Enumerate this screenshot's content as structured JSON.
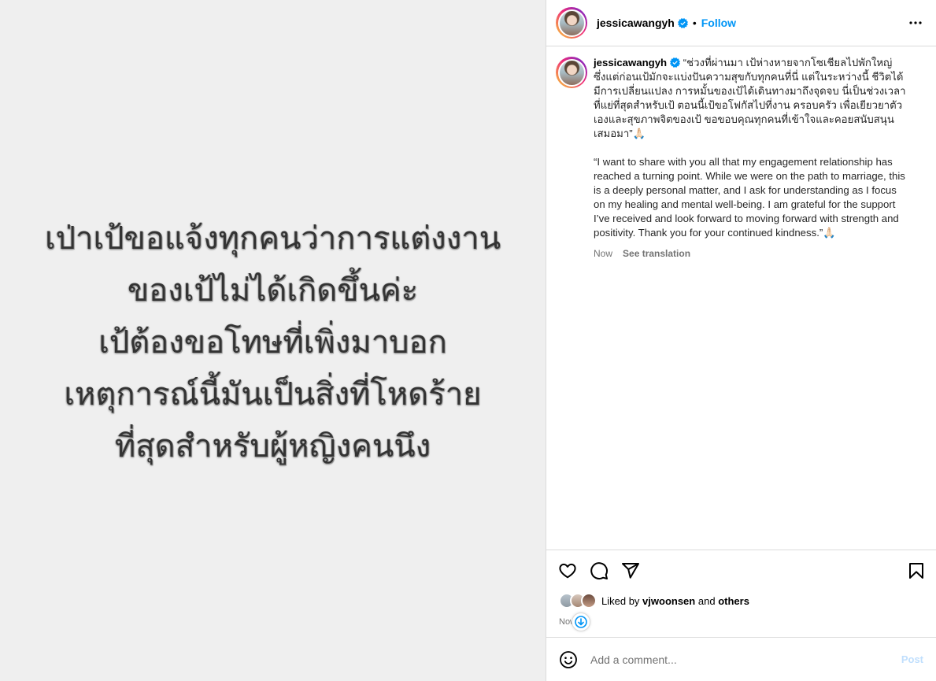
{
  "media": {
    "lines": [
      "เป่าเป้ขอแจ้งทุกคนว่าการแต่งงาน",
      "ของเป้ไม่ได้เกิดขึ้นค่ะ",
      "เป้ต้องขอโทษที่เพิ่งมาบอก",
      "เหตุการณ์นี้มันเป็นสิ่งที่โหดร้าย",
      "ที่สุดสำหรับผู้หญิงคนนึง"
    ]
  },
  "header": {
    "username": "jessicawangyh",
    "separator": "•",
    "follow_label": "Follow"
  },
  "caption": {
    "username": "jessicawangyh",
    "thai_text": "“ช่วงที่ผ่านมา เป้ห่างหายจากโซเชียลไปพักใหญ่ ซึ่งแต่ก่อนเป้มักจะแบ่งปันความสุขกับทุกคนที่นี่ แต่ในระหว่างนี้ ชีวิตได้มีการเปลี่ยนแปลง การหมั้นของเป้ได้เดินทางมาถึงจุดจบ นี่เป็นช่วงเวลาที่แย่ที่สุดสำหรับเป้ ตอนนี้เป้ขอโฟกัสไปที่งาน ครอบครัว เพื่อเยียวยาตัวเองและสุขภาพจิตของเป้ ขอขอบคุณทุกคนที่เข้าใจและคอยสนับสนุนเสมอมา”🙏🏻",
    "english_text": "“I want to share with you all that my engagement relationship has reached a turning point. While we were on the path to marriage, this is a deeply personal matter, and I ask for understanding as I focus on my healing and mental well-being. I am grateful for the support I’ve received and look forward to moving forward with strength and positivity. Thank you for your continued kindness.”🙏🏻",
    "time": "Now",
    "see_translation": "See translation"
  },
  "likes": {
    "prefix": "Liked by",
    "user": "vjwoonsen",
    "connector": "and",
    "others": "others"
  },
  "timestamp": "Now",
  "comment_box": {
    "placeholder": "Add a comment...",
    "post_label": "Post"
  },
  "colors": {
    "accent": "#0095f6",
    "verified": "#0095f6",
    "media_bg": "#efefef",
    "post_disabled": "#c0dffd"
  },
  "icons": {
    "like": "heart-icon",
    "comment": "comment-icon",
    "share": "paper-plane-icon",
    "save": "bookmark-icon",
    "more": "more-options-icon",
    "emoji": "emoji-icon",
    "verified": "verified-badge-icon",
    "scroll": "arrow-down-icon"
  }
}
